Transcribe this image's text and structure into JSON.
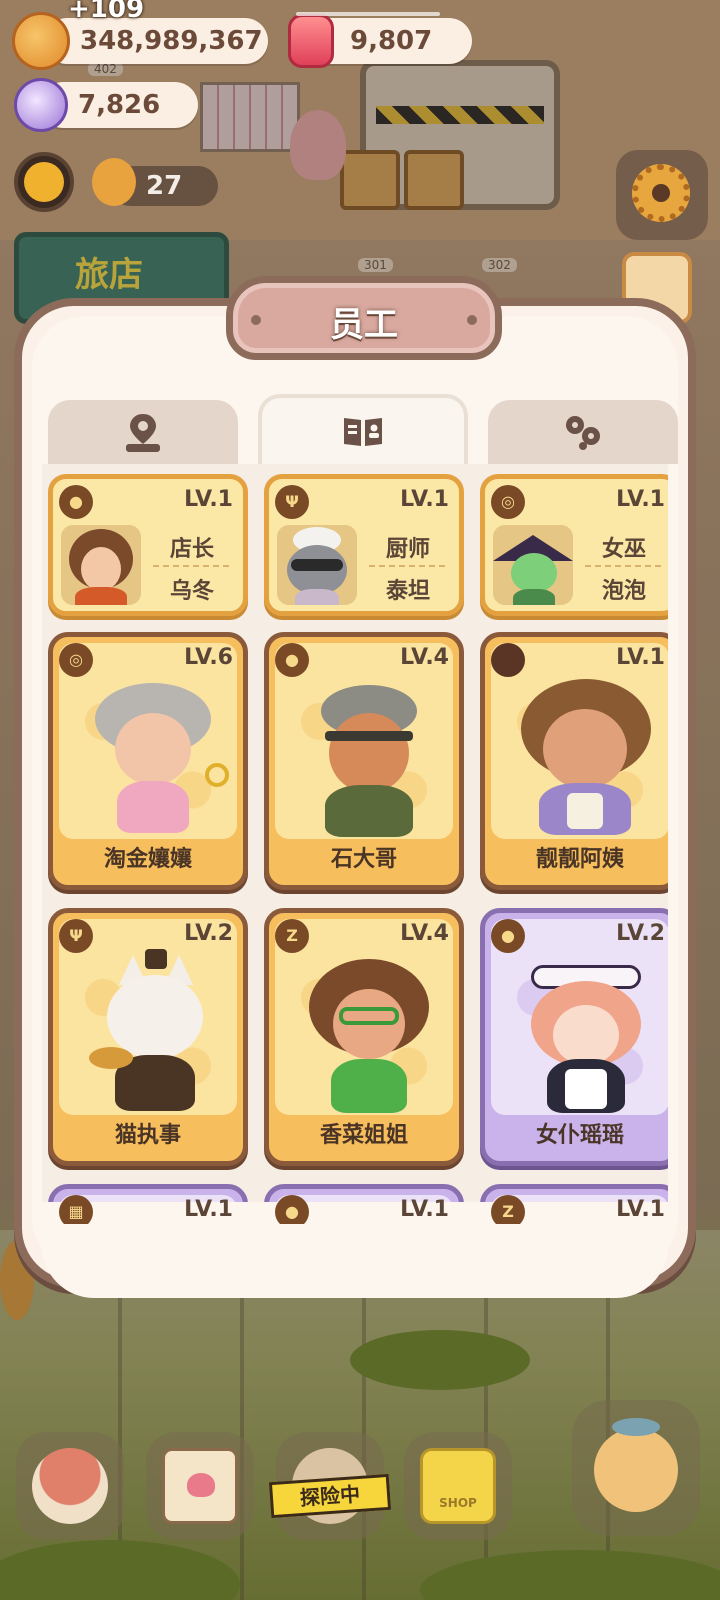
{
  "hud": {
    "coins": "348,989,367",
    "coin_gain": "+109",
    "gems": "9,807",
    "crystals": "7,826",
    "level_count": "27"
  },
  "background": {
    "signboard_text": "旅店",
    "room_numbers": [
      "402",
      "301",
      "302"
    ]
  },
  "modal": {
    "title": "员工",
    "tabs": [
      {
        "icon": "location-pin-icon",
        "active": false
      },
      {
        "icon": "book-icon",
        "active": true
      },
      {
        "icon": "paw-icon",
        "active": false
      }
    ]
  },
  "role_cards": [
    {
      "badge_icon": "bread-icon",
      "level": "LV.1",
      "role": "店长",
      "name": "乌冬"
    },
    {
      "badge_icon": "fork-knife-icon",
      "level": "LV.1",
      "role": "厨师",
      "name": "泰坦"
    },
    {
      "badge_icon": "pot-icon",
      "level": "LV.1",
      "role": "女巫",
      "name": "泡泡"
    }
  ],
  "staff_cards": [
    {
      "badge_icon": "pot-icon",
      "level": "LV.6",
      "name": "淘金孃孃",
      "theme": "orange"
    },
    {
      "badge_icon": "bread-icon",
      "level": "LV.4",
      "name": "石大哥",
      "theme": "orange"
    },
    {
      "badge_icon": "brown-dot-icon",
      "level": "LV.1",
      "name": "靓靓阿姨",
      "theme": "orange"
    },
    {
      "badge_icon": "fork-knife-icon",
      "level": "LV.2",
      "name": "猫执事",
      "theme": "orange"
    },
    {
      "badge_icon": "z-icon",
      "level": "LV.4",
      "name": "香菜姐姐",
      "theme": "orange"
    },
    {
      "badge_icon": "bread-icon",
      "level": "LV.2",
      "name": "女仆瑶瑶",
      "theme": "purple"
    }
  ],
  "partial_cards": [
    {
      "level": "LV.1",
      "theme": "purple"
    },
    {
      "level": "LV.1",
      "theme": "purple"
    },
    {
      "level": "LV.1",
      "theme": "purple"
    }
  ],
  "bottom_bar": {
    "exploring_label": "探险中",
    "bag_label": "SHOP"
  },
  "colors": {
    "accent_orange": "#f6be5c",
    "accent_purple": "#c9b3ea",
    "frame_brown": "#8c6b5a",
    "text_brown": "#5a4536"
  }
}
